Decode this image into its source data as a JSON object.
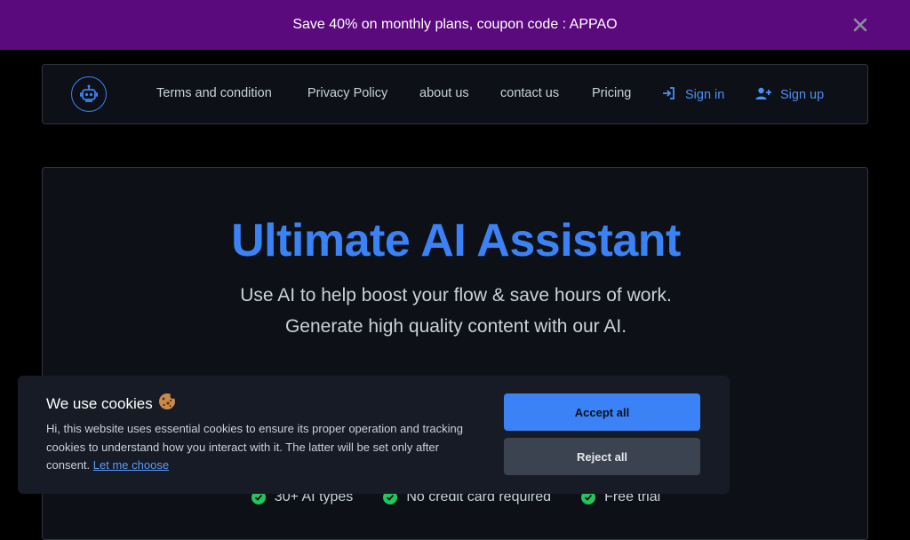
{
  "promo": {
    "text": "Save 40% on monthly plans, coupon code : APPAO"
  },
  "nav": {
    "links": [
      "Terms and condition",
      "Privacy Policy",
      "about us",
      "contact us",
      "Pricing"
    ],
    "sign_in": "Sign in",
    "sign_up": "Sign up"
  },
  "hero": {
    "title": "Ultimate AI Assistant",
    "subtitle": "Use AI to help boost your flow & save hours of work. Generate high quality content with our AI.",
    "features": [
      "30+ AI types",
      "No credit card required",
      "Free trial"
    ]
  },
  "cookie": {
    "title": "We use cookies",
    "text": "Hi, this website uses essential cookies to ensure its proper operation and tracking cookies to understand how you interact with it. The latter will be set only after consent.",
    "link": "Let me choose",
    "accept": "Accept all",
    "reject": "Reject all"
  },
  "colors": {
    "promo_bg": "#5b0a7e",
    "accent": "#3b82f6",
    "success": "#22c55e",
    "panel_bg": "#0d1117"
  }
}
